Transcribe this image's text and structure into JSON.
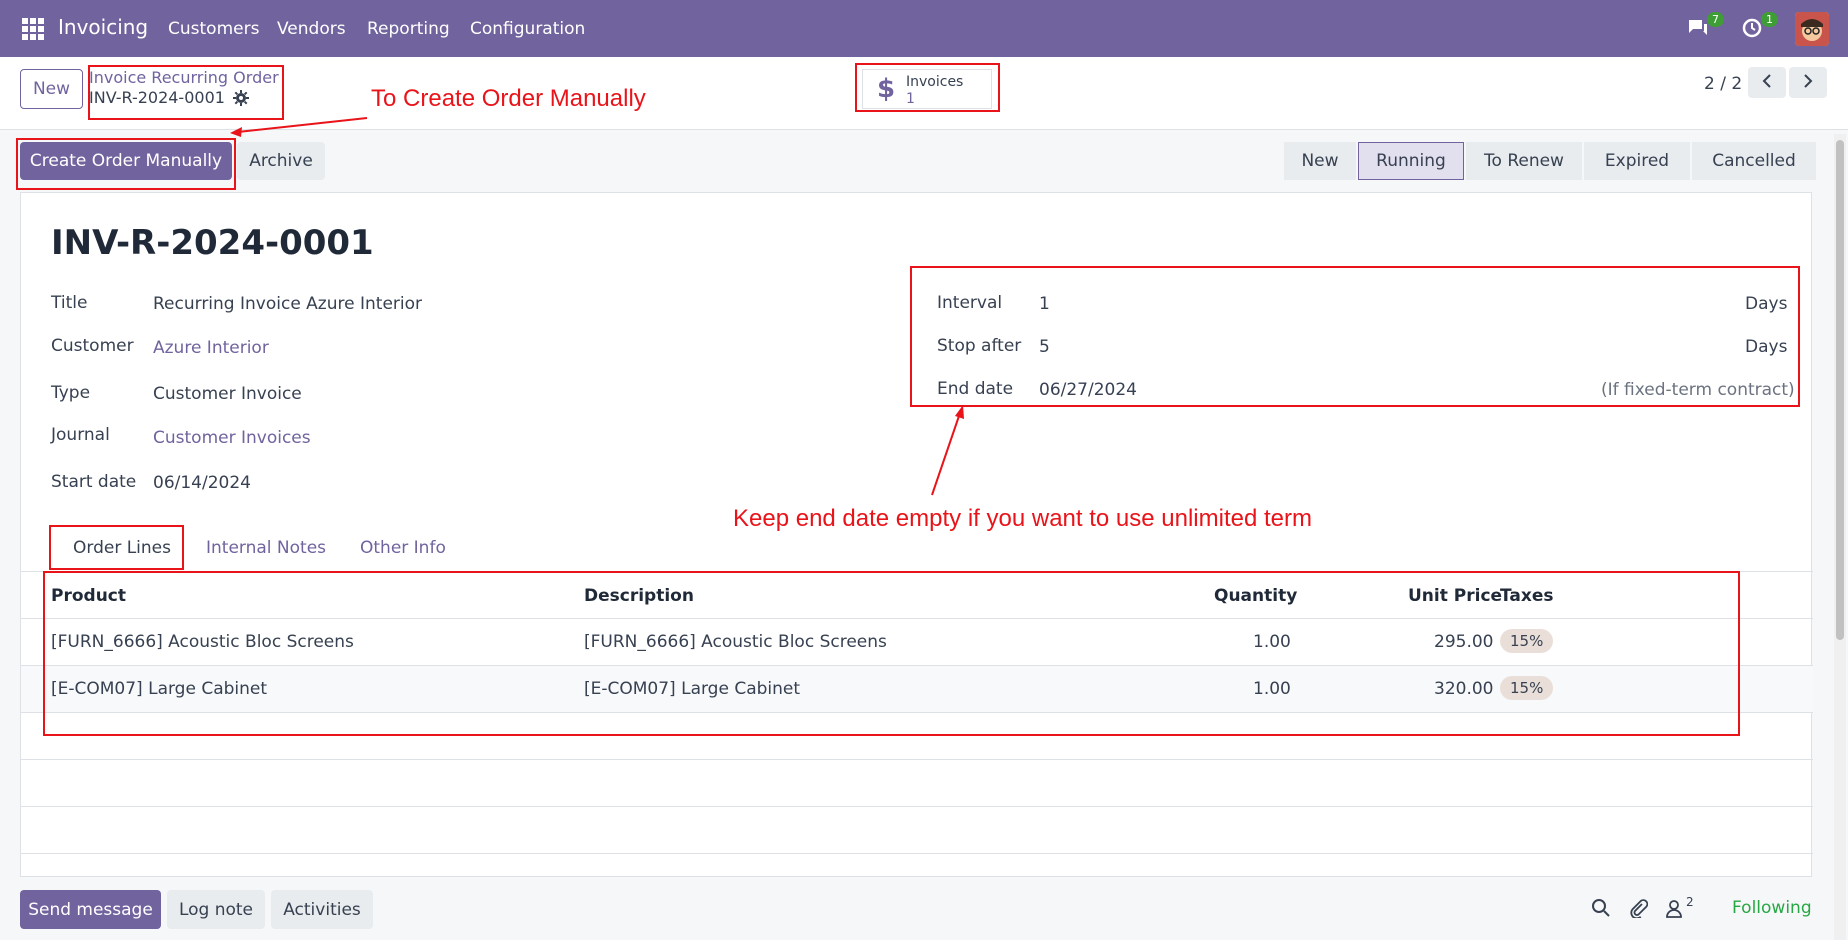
{
  "navbar": {
    "app_name": "Invoicing",
    "menu": [
      "Customers",
      "Vendors",
      "Reporting",
      "Configuration"
    ],
    "messages_badge": "7",
    "activities_badge": "1"
  },
  "control_panel": {
    "new_label": "New",
    "breadcrumb_parent": "Invoice Recurring Order",
    "breadcrumb_current": "INV-R-2024-0001",
    "smart_button": {
      "label": "Invoices",
      "value": "1"
    },
    "pager": "2 / 2"
  },
  "actions": {
    "create_order_label": "Create Order Manually",
    "archive_label": "Archive"
  },
  "statusbar": {
    "stages": [
      "New",
      "Running",
      "To Renew",
      "Expired",
      "Cancelled"
    ],
    "active": "Running"
  },
  "form": {
    "title": "INV-R-2024-0001",
    "fields_left": [
      {
        "label": "Title",
        "value": "Recurring Invoice Azure Interior"
      },
      {
        "label": "Customer",
        "value": "Azure Interior"
      },
      {
        "label": "Type",
        "value": "Customer Invoice"
      },
      {
        "label": "Journal",
        "value": "Customer Invoices"
      },
      {
        "label": "Start date",
        "value": "06/14/2024"
      }
    ],
    "fields_right": [
      {
        "label": "Interval",
        "value": "1",
        "unit": "Days"
      },
      {
        "label": "Stop after",
        "value": "5",
        "unit": "Days"
      },
      {
        "label": "End date",
        "value": "06/27/2024",
        "unit": "(If fixed-term contract)"
      }
    ]
  },
  "tabs": [
    "Order Lines",
    "Internal Notes",
    "Other Info"
  ],
  "order_lines": {
    "headers": [
      "Product",
      "Description",
      "Quantity",
      "Unit Price",
      "Taxes"
    ],
    "rows": [
      {
        "product": "[FURN_6666] Acoustic Bloc Screens",
        "description": "[FURN_6666] Acoustic Bloc Screens",
        "quantity": "1.00",
        "unit_price": "295.00",
        "tax": "15%"
      },
      {
        "product": "[E-COM07] Large Cabinet",
        "description": "[E-COM07] Large Cabinet",
        "quantity": "1.00",
        "unit_price": "320.00",
        "tax": "15%"
      }
    ]
  },
  "annotations": {
    "create_manual": "To Create Order Manually",
    "end_date_hint": "Keep end date empty if you want to use unlimited term"
  },
  "chatter": {
    "send_message": "Send message",
    "log_note": "Log note",
    "activities": "Activities",
    "followers_count": "2",
    "following": "Following"
  },
  "colors": {
    "brand": "#71639e",
    "annotation": "#e8141a",
    "following": "#28a745"
  }
}
